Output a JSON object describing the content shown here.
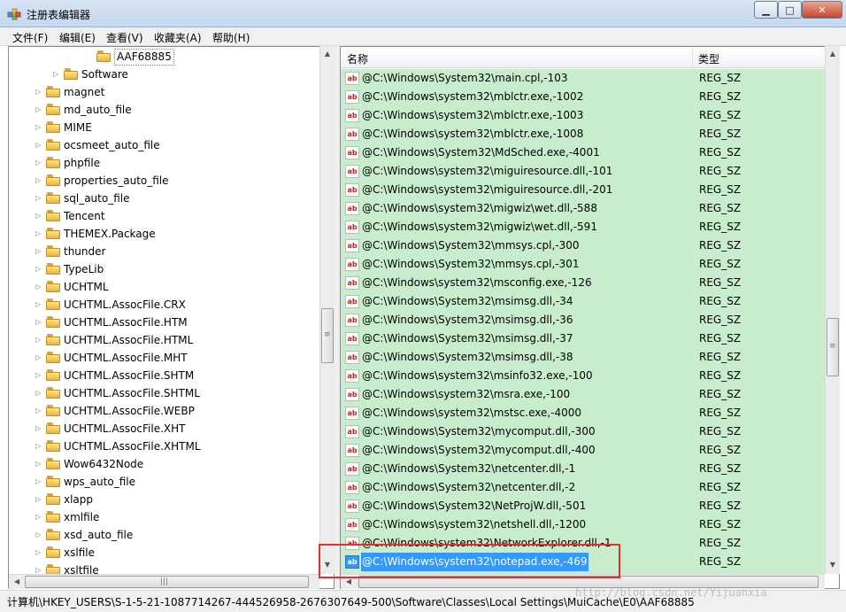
{
  "window": {
    "title": "注册表编辑器",
    "controls": {
      "minimize": "▁",
      "maximize": "□",
      "close": "✕"
    }
  },
  "menu": [
    "文件(F)",
    "编辑(E)",
    "查看(V)",
    "收藏夹(A)",
    "帮助(H)"
  ],
  "tree": {
    "items": [
      {
        "label": "AAF68885",
        "level": 2,
        "expander": ""
      },
      {
        "label": "Software",
        "level": 1,
        "expander": "▷"
      },
      {
        "label": "magnet",
        "level": 0,
        "expander": "▷"
      },
      {
        "label": "md_auto_file",
        "level": 0,
        "expander": "▷"
      },
      {
        "label": "MIME",
        "level": 0,
        "expander": "▷"
      },
      {
        "label": "ocsmeet_auto_file",
        "level": 0,
        "expander": "▷"
      },
      {
        "label": "phpfile",
        "level": 0,
        "expander": "▷"
      },
      {
        "label": "properties_auto_file",
        "level": 0,
        "expander": "▷"
      },
      {
        "label": "sql_auto_file",
        "level": 0,
        "expander": "▷"
      },
      {
        "label": "Tencent",
        "level": 0,
        "expander": "▷"
      },
      {
        "label": "THEMEX.Package",
        "level": 0,
        "expander": "▷"
      },
      {
        "label": "thunder",
        "level": 0,
        "expander": "▷"
      },
      {
        "label": "TypeLib",
        "level": 0,
        "expander": "▷"
      },
      {
        "label": "UCHTML",
        "level": 0,
        "expander": "▷"
      },
      {
        "label": "UCHTML.AssocFile.CRX",
        "level": 0,
        "expander": "▷"
      },
      {
        "label": "UCHTML.AssocFile.HTM",
        "level": 0,
        "expander": "▷"
      },
      {
        "label": "UCHTML.AssocFile.HTML",
        "level": 0,
        "expander": "▷"
      },
      {
        "label": "UCHTML.AssocFile.MHT",
        "level": 0,
        "expander": "▷"
      },
      {
        "label": "UCHTML.AssocFile.SHTM",
        "level": 0,
        "expander": "▷"
      },
      {
        "label": "UCHTML.AssocFile.SHTML",
        "level": 0,
        "expander": "▷"
      },
      {
        "label": "UCHTML.AssocFile.WEBP",
        "level": 0,
        "expander": "▷"
      },
      {
        "label": "UCHTML.AssocFile.XHT",
        "level": 0,
        "expander": "▷"
      },
      {
        "label": "UCHTML.AssocFile.XHTML",
        "level": 0,
        "expander": "▷"
      },
      {
        "label": "Wow6432Node",
        "level": 0,
        "expander": "▷"
      },
      {
        "label": "wps_auto_file",
        "level": 0,
        "expander": "▷"
      },
      {
        "label": "xlapp",
        "level": 0,
        "expander": "▷"
      },
      {
        "label": "xmlfile",
        "level": 0,
        "expander": "▷"
      },
      {
        "label": "xsd_auto_file",
        "level": 0,
        "expander": "▷"
      },
      {
        "label": "xslfile",
        "level": 0,
        "expander": "▷"
      },
      {
        "label": "xsltfile",
        "level": 0,
        "expander": "▷"
      }
    ]
  },
  "list": {
    "headers": {
      "name": "名称",
      "type": "类型"
    },
    "icon_text": "ab",
    "rows": [
      {
        "name": "@C:\\Windows\\System32\\main.cpl,-103",
        "type": "REG_SZ"
      },
      {
        "name": "@C:\\Windows\\system32\\mblctr.exe,-1002",
        "type": "REG_SZ"
      },
      {
        "name": "@C:\\Windows\\system32\\mblctr.exe,-1003",
        "type": "REG_SZ"
      },
      {
        "name": "@C:\\Windows\\system32\\mblctr.exe,-1008",
        "type": "REG_SZ"
      },
      {
        "name": "@C:\\Windows\\System32\\MdSched.exe,-4001",
        "type": "REG_SZ"
      },
      {
        "name": "@C:\\Windows\\system32\\miguiresource.dll,-101",
        "type": "REG_SZ"
      },
      {
        "name": "@C:\\Windows\\system32\\miguiresource.dll,-201",
        "type": "REG_SZ"
      },
      {
        "name": "@C:\\Windows\\system32\\migwiz\\wet.dll,-588",
        "type": "REG_SZ"
      },
      {
        "name": "@C:\\Windows\\system32\\migwiz\\wet.dll,-591",
        "type": "REG_SZ"
      },
      {
        "name": "@C:\\Windows\\System32\\mmsys.cpl,-300",
        "type": "REG_SZ"
      },
      {
        "name": "@C:\\Windows\\System32\\mmsys.cpl,-301",
        "type": "REG_SZ"
      },
      {
        "name": "@C:\\Windows\\system32\\msconfig.exe,-126",
        "type": "REG_SZ"
      },
      {
        "name": "@C:\\Windows\\System32\\msimsg.dll,-34",
        "type": "REG_SZ"
      },
      {
        "name": "@C:\\Windows\\System32\\msimsg.dll,-36",
        "type": "REG_SZ"
      },
      {
        "name": "@C:\\Windows\\System32\\msimsg.dll,-37",
        "type": "REG_SZ"
      },
      {
        "name": "@C:\\Windows\\System32\\msimsg.dll,-38",
        "type": "REG_SZ"
      },
      {
        "name": "@C:\\Windows\\system32\\msinfo32.exe,-100",
        "type": "REG_SZ"
      },
      {
        "name": "@C:\\Windows\\system32\\msra.exe,-100",
        "type": "REG_SZ"
      },
      {
        "name": "@C:\\Windows\\system32\\mstsc.exe,-4000",
        "type": "REG_SZ"
      },
      {
        "name": "@C:\\Windows\\System32\\mycomput.dll,-300",
        "type": "REG_SZ"
      },
      {
        "name": "@C:\\Windows\\System32\\mycomput.dll,-400",
        "type": "REG_SZ"
      },
      {
        "name": "@C:\\Windows\\System32\\netcenter.dll,-1",
        "type": "REG_SZ"
      },
      {
        "name": "@C:\\Windows\\System32\\netcenter.dll,-2",
        "type": "REG_SZ"
      },
      {
        "name": "@C:\\Windows\\System32\\NetProjW.dll,-501",
        "type": "REG_SZ"
      },
      {
        "name": "@C:\\Windows\\system32\\netshell.dll,-1200",
        "type": "REG_SZ"
      },
      {
        "name": "@C:\\Windows\\system32\\NetworkExplorer.dll,-1",
        "type": "REG_SZ"
      },
      {
        "name": "@C:\\Windows\\system32\\notepad.exe,-469",
        "type": "REG_SZ",
        "selected": true
      }
    ]
  },
  "status": {
    "path": "计算机\\HKEY_USERS\\S-1-5-21-1087714267-444526958-2676307649-500\\Software\\Classes\\Local Settings\\MuiCache\\E0\\AAF68885"
  },
  "watermark": "http://blog.csdn.net/Yijuanxia",
  "scrollbars": {
    "up": "▲",
    "down": "▼",
    "left": "◀",
    "right": "▶",
    "grip_v": "≡",
    "grip_h": "|||"
  }
}
